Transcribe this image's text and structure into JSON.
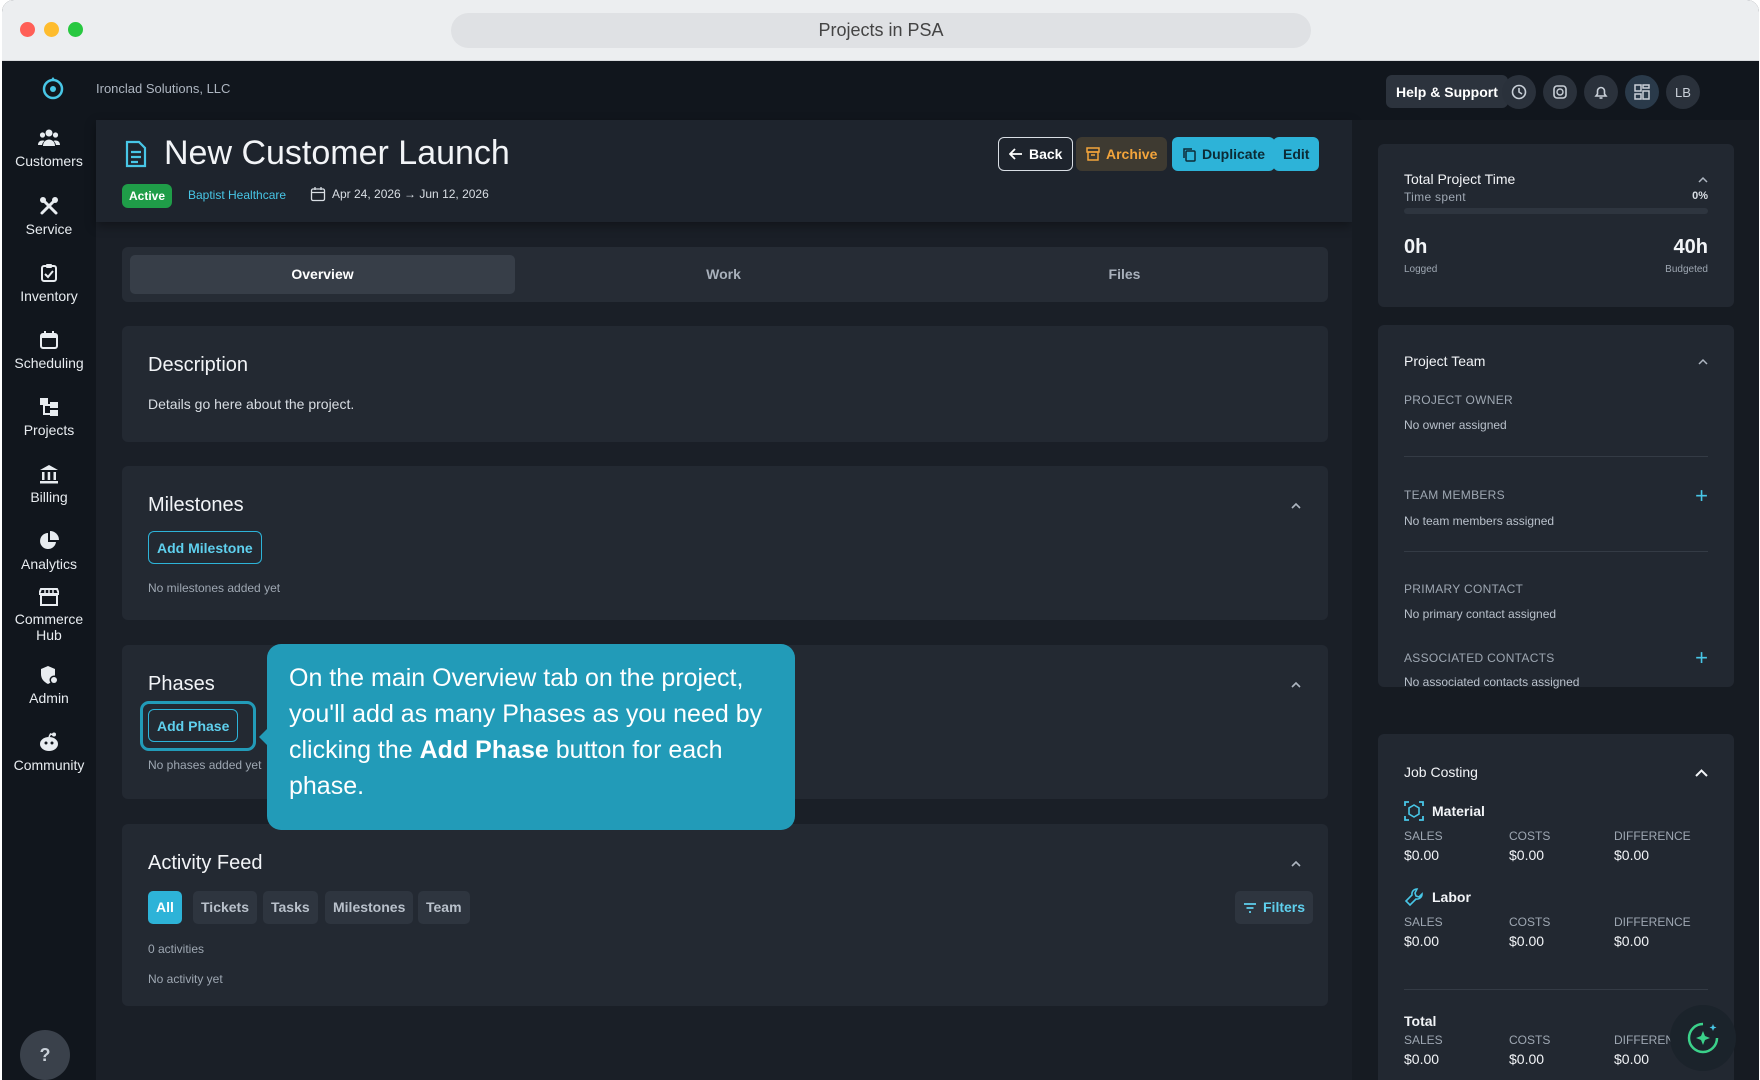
{
  "browser": {
    "url_title": "Projects in PSA"
  },
  "topbar": {
    "org_name": "Ironclad Solutions, LLC",
    "help_label": "Help & Support",
    "avatar_initials": "LB"
  },
  "sidebar": {
    "items": [
      {
        "label": "Customers",
        "icon": "customers-icon"
      },
      {
        "label": "Service",
        "icon": "service-icon"
      },
      {
        "label": "Inventory",
        "icon": "inventory-icon"
      },
      {
        "label": "Scheduling",
        "icon": "calendar-icon"
      },
      {
        "label": "Projects",
        "icon": "projects-icon"
      },
      {
        "label": "Billing",
        "icon": "billing-icon"
      },
      {
        "label": "Analytics",
        "icon": "analytics-icon"
      },
      {
        "label": "Commerce Hub",
        "icon": "store-icon"
      },
      {
        "label": "Admin",
        "icon": "admin-icon"
      },
      {
        "label": "Community",
        "icon": "community-icon"
      }
    ],
    "help_label": "?"
  },
  "header": {
    "title": "New Customer Launch",
    "status": "Active",
    "customer": "Baptist Healthcare",
    "dates": "Apr 24, 2026 → Jun 12, 2026",
    "back_label": "Back",
    "archive_label": "Archive",
    "duplicate_label": "Duplicate",
    "edit_label": "Edit"
  },
  "tabs": [
    {
      "label": "Overview",
      "active": true
    },
    {
      "label": "Work",
      "active": false
    },
    {
      "label": "Files",
      "active": false
    }
  ],
  "description": {
    "title": "Description",
    "text": "Details go here about the project."
  },
  "milestones": {
    "title": "Milestones",
    "add_label": "Add Milestone",
    "empty": "No milestones added yet"
  },
  "phases": {
    "title": "Phases",
    "add_label": "Add Phase",
    "empty": "No phases added yet"
  },
  "tooltip": {
    "text_before": "On the main Overview tab on the project, you'll add as many Phases as you need by clicking the ",
    "text_bold": "Add Phase",
    "text_after": " button for each phase."
  },
  "activity": {
    "title": "Activity Feed",
    "filters": [
      "All",
      "Tickets",
      "Tasks",
      "Milestones",
      "Team"
    ],
    "filters_button": "Filters",
    "count": "0 activities",
    "empty": "No activity yet"
  },
  "time": {
    "title": "Total Project Time",
    "subtitle": "Time spent",
    "percent": "0%",
    "progress": 0,
    "logged_value": "0h",
    "logged_label": "Logged",
    "budgeted_value": "40h",
    "budgeted_label": "Budgeted"
  },
  "team": {
    "title": "Project Team",
    "owner_label": "PROJECT OWNER",
    "owner_value": "No owner assigned",
    "members_label": "TEAM MEMBERS",
    "members_value": "No team members assigned",
    "primary_label": "PRIMARY CONTACT",
    "primary_value": "No primary contact assigned",
    "associated_label": "ASSOCIATED CONTACTS",
    "associated_value": "No associated contacts assigned"
  },
  "job_costing": {
    "title": "Job Costing",
    "sales_label": "SALES",
    "costs_label": "COSTS",
    "diff_label": "DIFFERENCE",
    "diff_label_truncated": "DIFFEREN",
    "material": {
      "title": "Material",
      "sales": "$0.00",
      "costs": "$0.00",
      "difference": "$0.00"
    },
    "labor": {
      "title": "Labor",
      "sales": "$0.00",
      "costs": "$0.00",
      "difference": "$0.00"
    },
    "total": {
      "title": "Total",
      "sales": "$0.00",
      "costs": "$0.00",
      "difference": "$0.00"
    }
  },
  "colors": {
    "accent": "#2db3d8",
    "active_green": "#1f9d48",
    "archive_orange": "#f3a43b",
    "tooltip_bg": "#229bb8"
  }
}
